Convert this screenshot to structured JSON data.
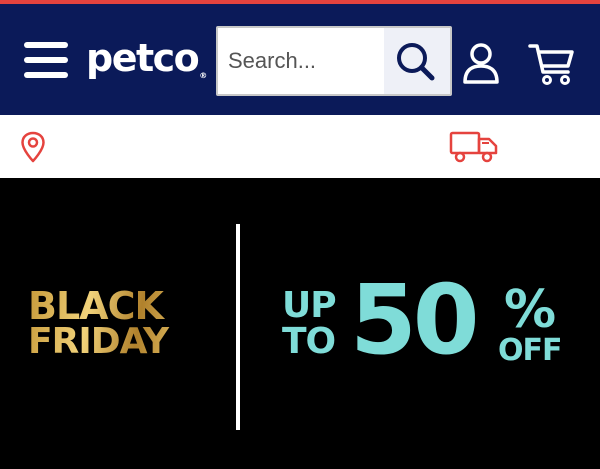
{
  "colors": {
    "header_bg": "#0b1a59",
    "accent_red": "#e5433e",
    "hero_bg": "#000000",
    "promo_teal": "#7fdcd8",
    "gold": "#d4a94a"
  },
  "header": {
    "logo_text": "petco",
    "logo_mark": "®",
    "menu_icon": "hamburger-menu-icon",
    "account_icon": "user-icon",
    "cart_icon": "shopping-cart-icon"
  },
  "search": {
    "placeholder": "Search...",
    "value": "",
    "button_icon": "search-icon"
  },
  "subbar": {
    "location_icon": "map-pin-icon",
    "delivery_icon": "delivery-truck-icon"
  },
  "hero": {
    "black": "BLACK",
    "friday": "FRIDAY",
    "up": "UP",
    "to": "TO",
    "amount": "50",
    "percent": "%",
    "off": "OFF"
  }
}
